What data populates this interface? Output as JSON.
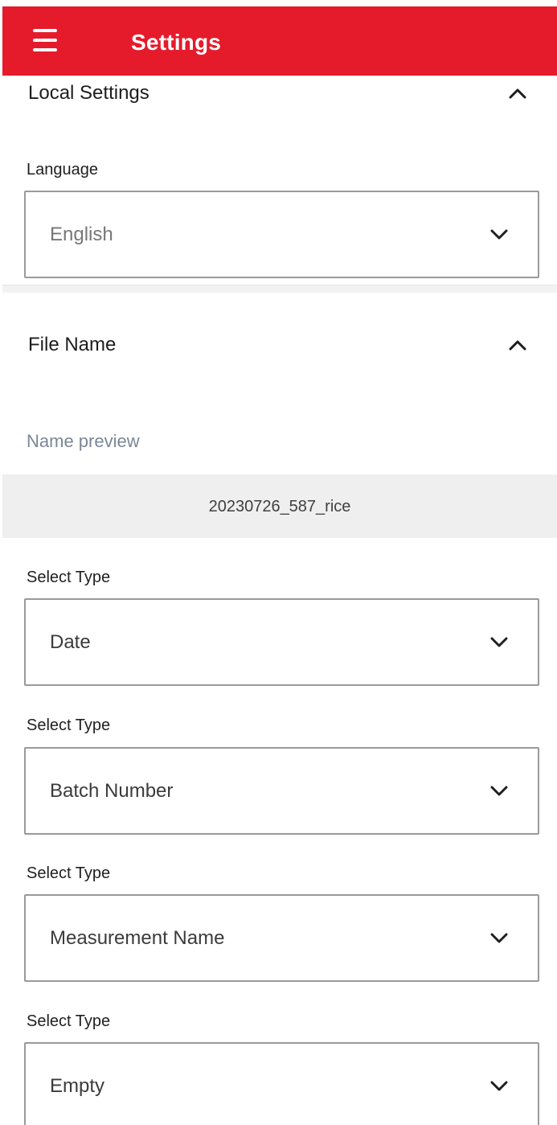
{
  "header": {
    "title": "Settings",
    "menu_icon": "menu-icon",
    "accent_color": "#e51b2b"
  },
  "local_settings": {
    "title": "Local Settings",
    "expanded": true,
    "language": {
      "label": "Language",
      "value": "English"
    }
  },
  "file_name": {
    "title": "File Name",
    "expanded": true,
    "preview": {
      "label": "Name preview",
      "value": "20230726_587_rice"
    },
    "selects": [
      {
        "label": "Select Type",
        "value": "Date"
      },
      {
        "label": "Select Type",
        "value": "Batch Number"
      },
      {
        "label": "Select Type",
        "value": "Measurement Name"
      },
      {
        "label": "Select Type",
        "value": "Empty"
      }
    ]
  },
  "icons": {
    "collapse": "chevron-up-icon",
    "dropdown": "chevron-down-icon"
  }
}
